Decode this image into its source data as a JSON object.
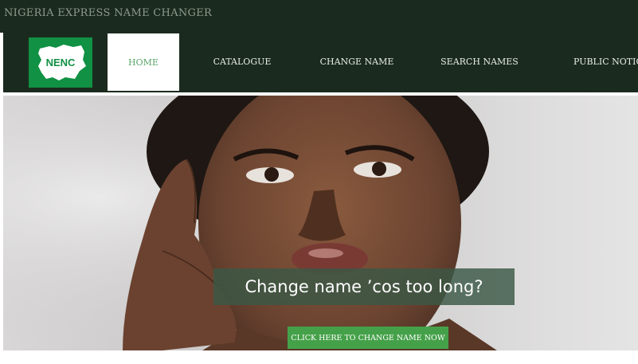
{
  "site": {
    "title": "NIGERIA EXPRESS NAME CHANGER",
    "logo_text": "NENC"
  },
  "nav": {
    "items": [
      {
        "label": "HOME",
        "active": true
      },
      {
        "label": "CATALOGUE",
        "active": false
      },
      {
        "label": "CHANGE NAME",
        "active": false
      },
      {
        "label": "SEARCH NAMES",
        "active": false
      },
      {
        "label": "PUBLIC NOTICE",
        "active": false
      }
    ]
  },
  "hero": {
    "caption": "Change name ’cos too long?",
    "cta_label": "CLICK HERE TO CHANGE NAME NOW"
  },
  "colors": {
    "header_bg": "#1b2a1e",
    "logo_green": "#119144",
    "cta_green": "#45a149",
    "caption_bg": "#3a5846"
  }
}
